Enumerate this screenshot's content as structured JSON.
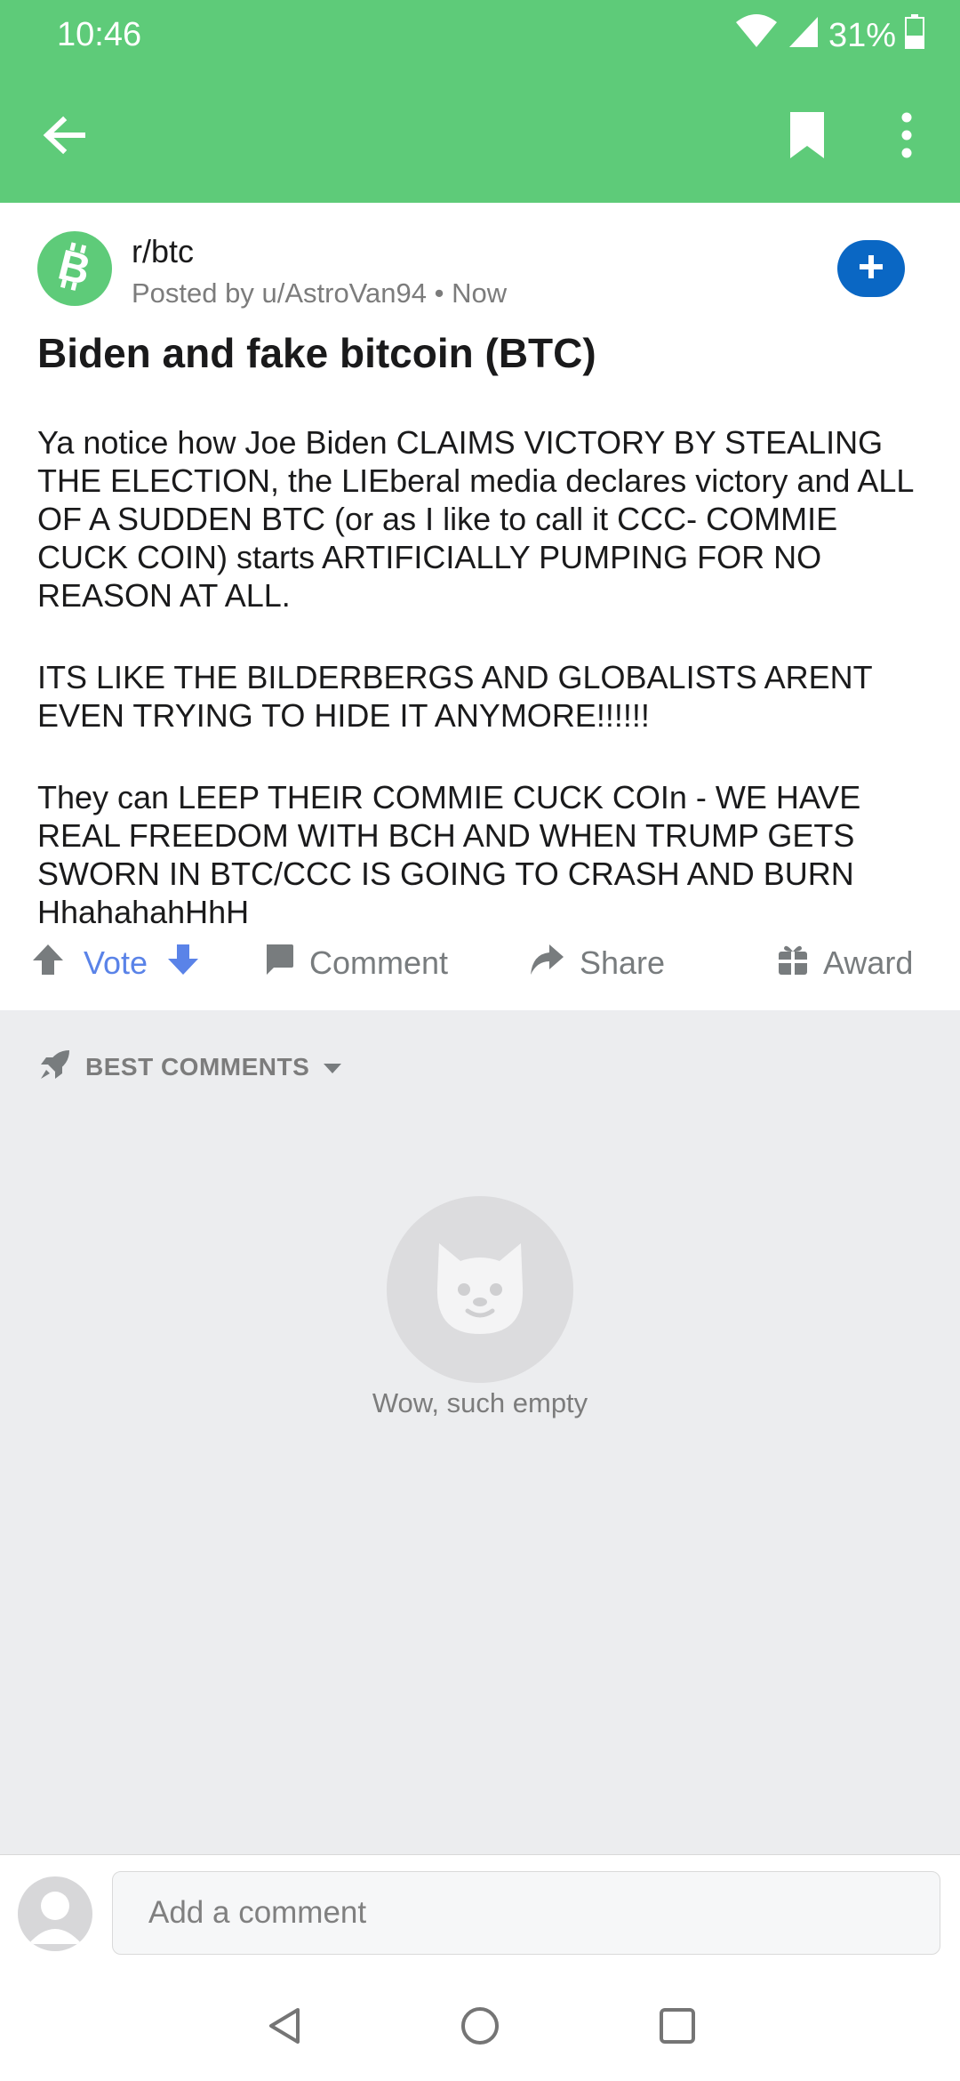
{
  "status_bar": {
    "time": "10:46",
    "battery": "31%"
  },
  "post": {
    "subreddit": "r/btc",
    "meta": "Posted by u/AstroVan94 • Now",
    "title": "Biden and fake bitcoin (BTC)",
    "body": [
      "Ya notice how Joe Biden CLAIMS VICTORY BY STEALING THE ELECTION, the LIEberal media declares victory and ALL OF A SUDDEN BTC (or as I like to call it CCC- COMMIE CUCK COIN) starts ARTIFICIALLY PUMPING FOR NO REASON AT ALL.",
      "ITS LIKE THE BILDERBERGS AND GLOBALISTS ARENT EVEN TRYING TO HIDE IT ANYMORE!!!!!!",
      "They can LEEP THEIR COMMIE CUCK COIn - WE HAVE REAL FREEDOM WITH BCH AND WHEN TRUMP GETS SWORN IN BTC/CCC IS GOING TO CRASH AND BURN HhahahahHhH"
    ],
    "actions": {
      "vote": "Vote",
      "comment": "Comment",
      "share": "Share",
      "award": "Award"
    }
  },
  "comments": {
    "sort_label": "BEST COMMENTS",
    "empty_text": "Wow, such empty"
  },
  "composer": {
    "placeholder": "Add a comment"
  },
  "colors": {
    "header_green": "#5ecb79",
    "join_blue": "#0a67c4",
    "vote_blue": "#5a83e8"
  },
  "icons": [
    "back-arrow-icon",
    "bookmark-icon",
    "more-vert-icon",
    "bitcoin-icon",
    "plus-icon",
    "upvote-icon",
    "downvote-icon",
    "comment-icon",
    "share-icon",
    "award-icon",
    "rocket-icon",
    "chevron-down-icon",
    "snoo-cat-icon",
    "user-icon"
  ]
}
